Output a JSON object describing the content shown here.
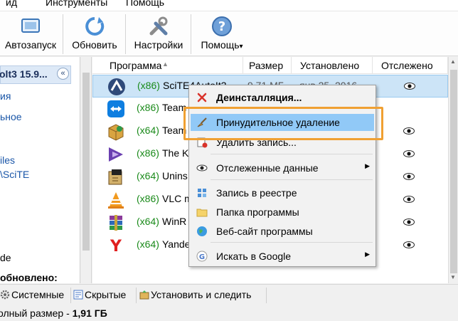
{
  "menubar": {
    "items": [
      "ид",
      "Инструменты",
      "Помощь"
    ]
  },
  "toolbar": {
    "buttons": [
      {
        "label": "Автозапуск",
        "icon": "autorun-icon"
      },
      {
        "label": "Обновить",
        "icon": "refresh-icon"
      },
      {
        "label": "Настройки",
        "icon": "settings-tools-icon"
      },
      {
        "label": "Помощь",
        "icon": "help-icon",
        "dropdown": "▾"
      }
    ]
  },
  "left_panel": {
    "header": "olt3 15.9...",
    "collapse_glyph": "«",
    "lines": [
      {
        "text": "ия",
        "style": "link"
      },
      {
        "text": "ьное",
        "style": "link"
      },
      {
        "text": "iles",
        "style": "link"
      },
      {
        "text": "\\SciTE",
        "style": "link"
      },
      {
        "text": "de",
        "style": "plain"
      },
      {
        "text": "обновлено:",
        "style": "bold"
      }
    ]
  },
  "list": {
    "columns": [
      "Программа",
      "Размер",
      "Установлено",
      "Отслежено"
    ],
    "rows": [
      {
        "arch": "(x86)",
        "name": "SciTE4AutoIt3",
        "size": "9,71 МБ",
        "date": "янв 25, 2016",
        "icon": "autoit-icon",
        "tracked": true,
        "selected": true
      },
      {
        "arch": "(x86)",
        "name": "Team",
        "size": "",
        "date": "",
        "icon": "teamviewer-icon",
        "tracked": false,
        "selected": false
      },
      {
        "arch": "(x64)",
        "name": "Team",
        "size": "",
        "date": "",
        "icon": "package-box-icon",
        "tracked": true,
        "selected": false
      },
      {
        "arch": "(x86)",
        "name": "The K",
        "size": "",
        "date": "",
        "icon": "kmplayer-icon",
        "tracked": true,
        "selected": false
      },
      {
        "arch": "(x64)",
        "name": "Unins",
        "size": "",
        "date": "",
        "icon": "uninstaller-icon",
        "tracked": true,
        "selected": false
      },
      {
        "arch": "(x86)",
        "name": "VLC m",
        "size": "",
        "date": "",
        "icon": "vlc-cone-icon",
        "tracked": true,
        "selected": false
      },
      {
        "arch": "(x64)",
        "name": "WinR",
        "size": "",
        "date": "",
        "icon": "winrar-icon",
        "tracked": true,
        "selected": false
      },
      {
        "arch": "(x64)",
        "name": "Yande",
        "size": "",
        "date": "",
        "icon": "yandex-icon",
        "tracked": true,
        "selected": false
      }
    ]
  },
  "context_menu": {
    "items": [
      {
        "label": "Деинсталляция...",
        "icon": "uninstall-x-icon",
        "bold": true,
        "submenu": false
      },
      {
        "label": "Принудительное удаление",
        "icon": "broom-icon",
        "highlighted": true,
        "submenu": false
      },
      {
        "label": "Удалить запись...",
        "icon": "delete-entry-icon",
        "submenu": false
      },
      {
        "label": "Отслеженные данные",
        "icon": "eye-icon",
        "submenu": true
      },
      {
        "label": "Запись в реестре",
        "icon": "registry-icon",
        "submenu": false
      },
      {
        "label": "Папка программы",
        "icon": "folder-icon",
        "submenu": false
      },
      {
        "label": "Веб-сайт программы",
        "icon": "globe-icon",
        "submenu": false
      },
      {
        "label": "Искать в Google",
        "icon": "google-icon",
        "submenu": true
      }
    ],
    "submenu_glyph": "▶"
  },
  "tabs": [
    {
      "label": "Системные",
      "icon": "gear-small-icon"
    },
    {
      "label": "Скрытые",
      "icon": "hidden-icon"
    },
    {
      "label": "Установить и следить",
      "icon": "install-track-icon"
    }
  ],
  "status": {
    "label": "олный размер - ",
    "value": "1,91 ГБ"
  },
  "colors": {
    "accent_highlight": "#91c9f7",
    "selection": "#cce4f7",
    "arch_green": "#1a8a1a",
    "callout_orange": "#f0a032"
  }
}
